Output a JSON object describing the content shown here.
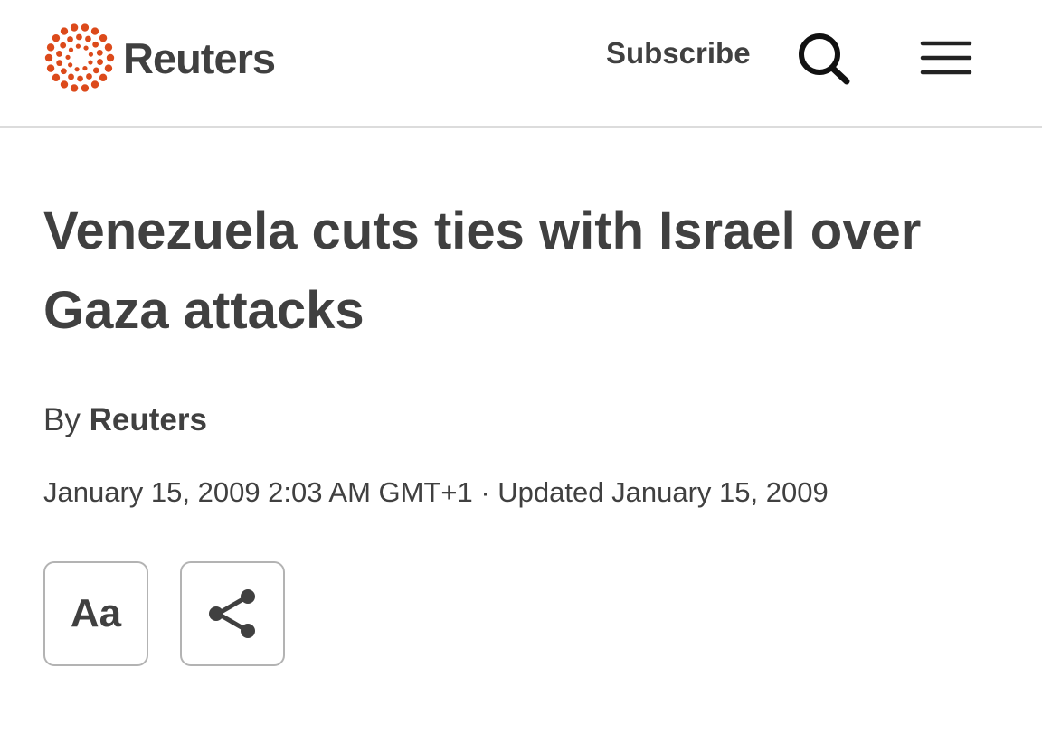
{
  "header": {
    "brand": "Reuters",
    "subscribe_label": "Subscribe",
    "search_icon": "search-icon",
    "menu_icon": "hamburger-menu-icon",
    "logo_color": "#dc4a1b"
  },
  "article": {
    "headline": "Venezuela cuts ties with Israel over Gaza attacks",
    "byline_prefix": "By",
    "byline_author": "Reuters",
    "dateline": "January 15, 2009 2:03 AM GMT+1 · Updated January 15, 2009"
  },
  "tools": {
    "font_size_label": "Aa",
    "share_icon": "share-icon"
  },
  "colors": {
    "text": "#404040",
    "divider": "#dcdcdc",
    "button_border": "#b3b3b3"
  }
}
